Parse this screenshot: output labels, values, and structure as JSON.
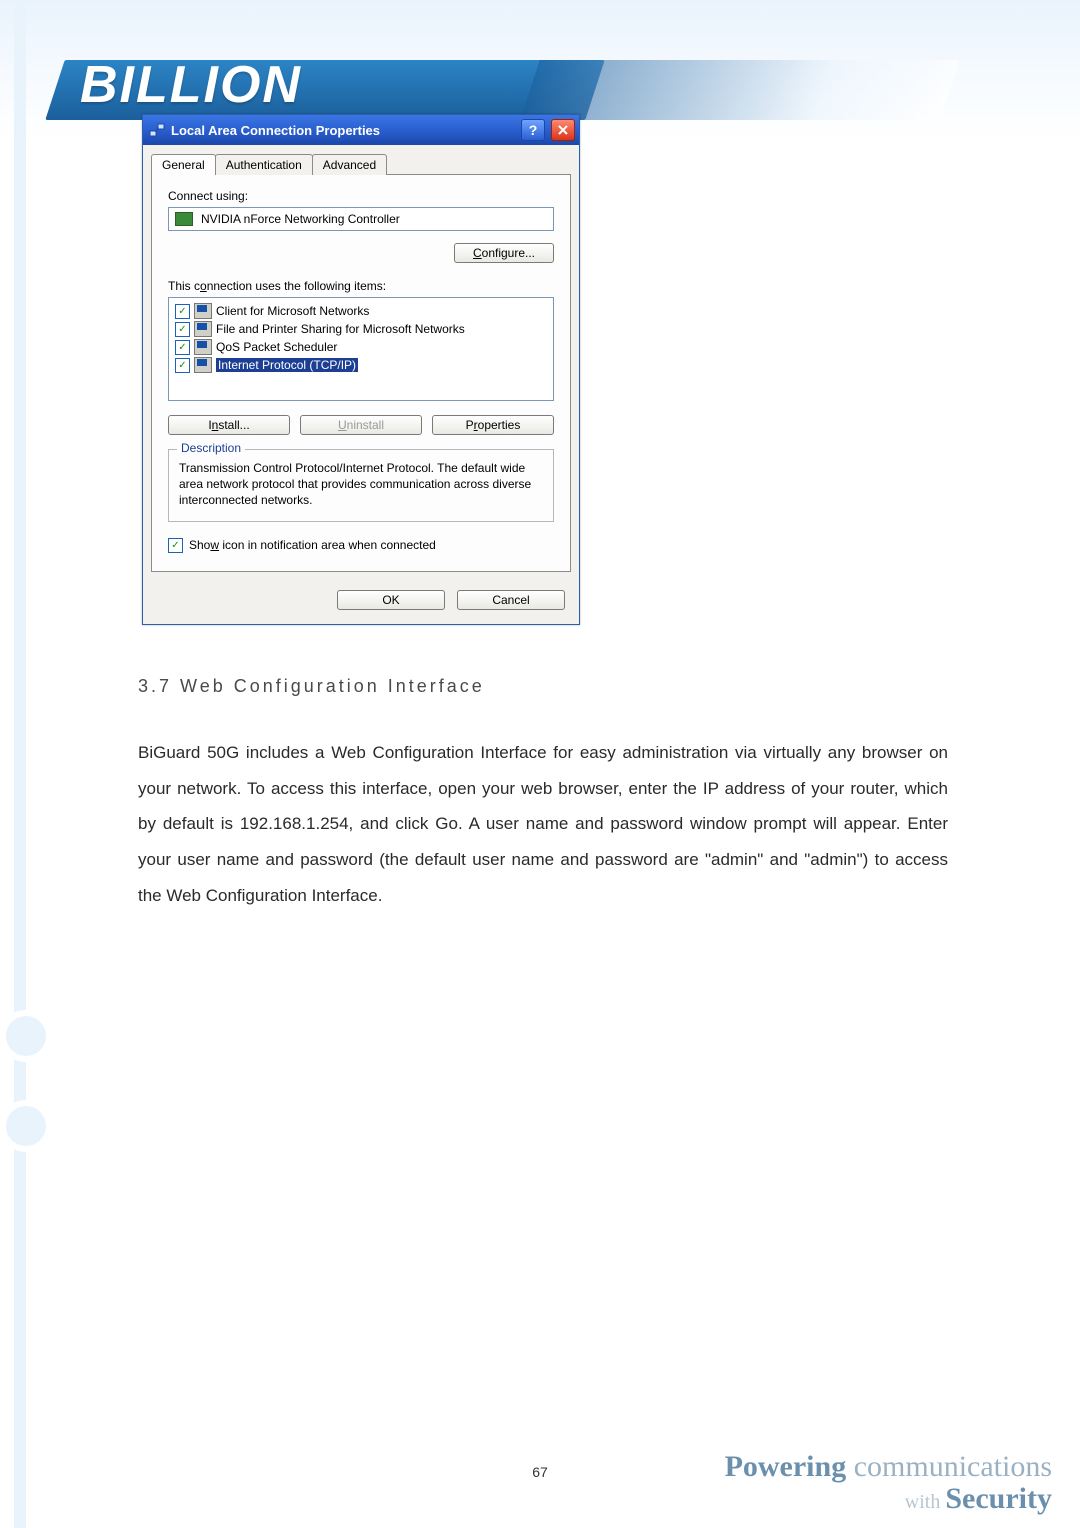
{
  "logo_text": "BILLION",
  "dialog": {
    "title": "Local Area Connection Properties",
    "tabs": {
      "general": "General",
      "authentication": "Authentication",
      "advanced": "Advanced"
    },
    "connect_using_label": "Connect using:",
    "adapter": "NVIDIA nForce Networking Controller",
    "configure_label": "Configure...",
    "items_label": "This connection uses the following items:",
    "items": [
      {
        "checked": true,
        "label": "Client for Microsoft Networks"
      },
      {
        "checked": true,
        "label": "File and Printer Sharing for Microsoft Networks"
      },
      {
        "checked": true,
        "label": "QoS Packet Scheduler"
      },
      {
        "checked": true,
        "label": "Internet Protocol (TCP/IP)"
      }
    ],
    "install_label": "Install...",
    "uninstall_label": "Uninstall",
    "properties_label": "Properties",
    "description_legend": "Description",
    "description_text": "Transmission Control Protocol/Internet Protocol. The default wide area network protocol that provides communication across diverse interconnected networks.",
    "show_icon_label": "Show icon in notification area when connected",
    "show_icon_checked": true,
    "ok_label": "OK",
    "cancel_label": "Cancel"
  },
  "doc": {
    "heading": "3.7   Web Configuration Interface",
    "paragraph": "BiGuard 50G includes a Web Configuration Interface for easy administration via virtually any browser on your network. To access this interface, open your web browser, enter the IP address of your router, which by default is 192.168.1.254, and click Go. A user name and password window prompt will appear. Enter your user name and password (the default user name and password are \"admin\" and \"admin\") to access the Web Configuration Interface."
  },
  "page_number": "67",
  "footer": {
    "line1a": "Powering",
    "line1b": " communications",
    "line2a": "with ",
    "line2b": "Security"
  }
}
